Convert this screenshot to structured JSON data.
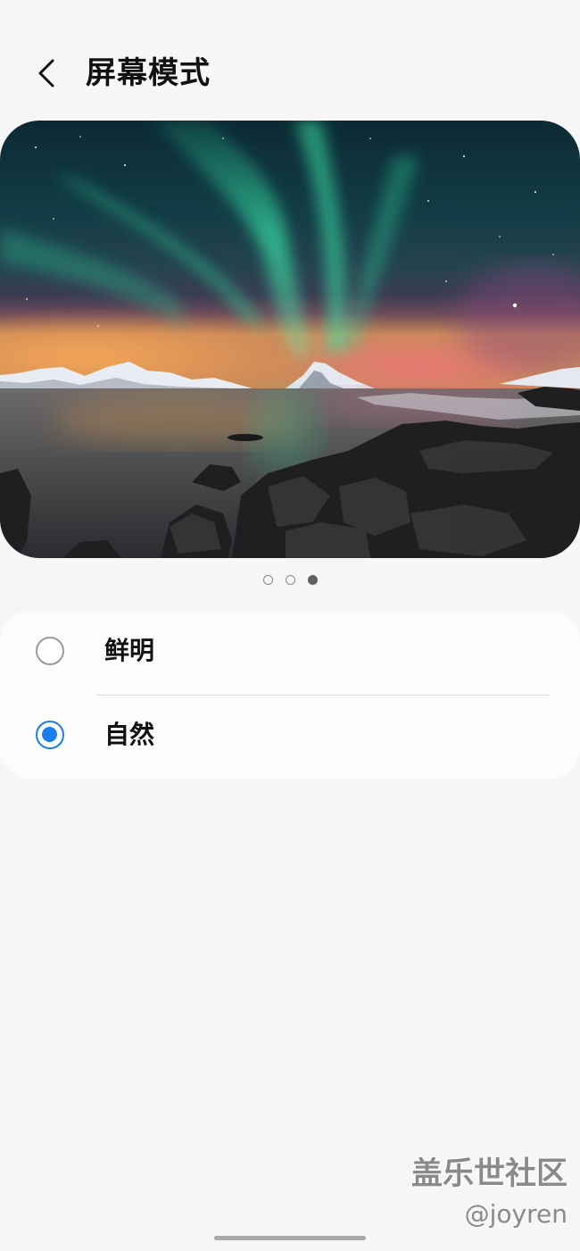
{
  "header": {
    "title": "屏幕模式",
    "back_icon": "chevron-left-icon"
  },
  "preview": {
    "page_count": 3,
    "active_page": 3
  },
  "options": [
    {
      "label": "鲜明",
      "selected": false
    },
    {
      "label": "自然",
      "selected": true
    }
  ],
  "colors": {
    "background": "#f6f6f6",
    "card": "#fcfcfc",
    "accent": "#1a7ef0"
  },
  "watermark": {
    "line1": "盖乐世社区",
    "line2": "@joyren"
  }
}
